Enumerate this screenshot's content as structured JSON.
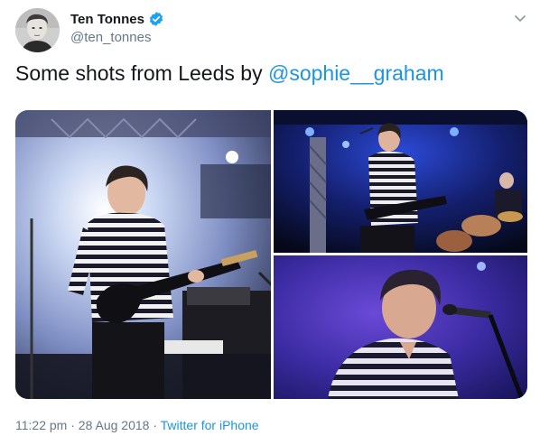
{
  "author": {
    "display_name": "Ten Tonnes",
    "handle": "@ten_tonnes",
    "verified": true,
    "avatar_icon": "avatar-photo"
  },
  "tweet": {
    "text_prefix": "Some shots from Leeds by ",
    "mention": "@sophie__graham"
  },
  "media": {
    "photos": [
      {
        "name": "guitarist-striped-shirt-stage-left"
      },
      {
        "name": "guitarist-with-drummer-blue-lights"
      },
      {
        "name": "singer-closeup-microphone"
      }
    ]
  },
  "meta": {
    "time": "11:22 pm",
    "separator1": " · ",
    "date": "28 Aug 2018",
    "separator2": " · ",
    "source": "Twitter for iPhone"
  },
  "colors": {
    "link": "#1b95e0",
    "secondary_text": "#657786",
    "verified": "#1da1f2"
  },
  "icons": [
    "verified-icon",
    "chevron-down-icon"
  ]
}
